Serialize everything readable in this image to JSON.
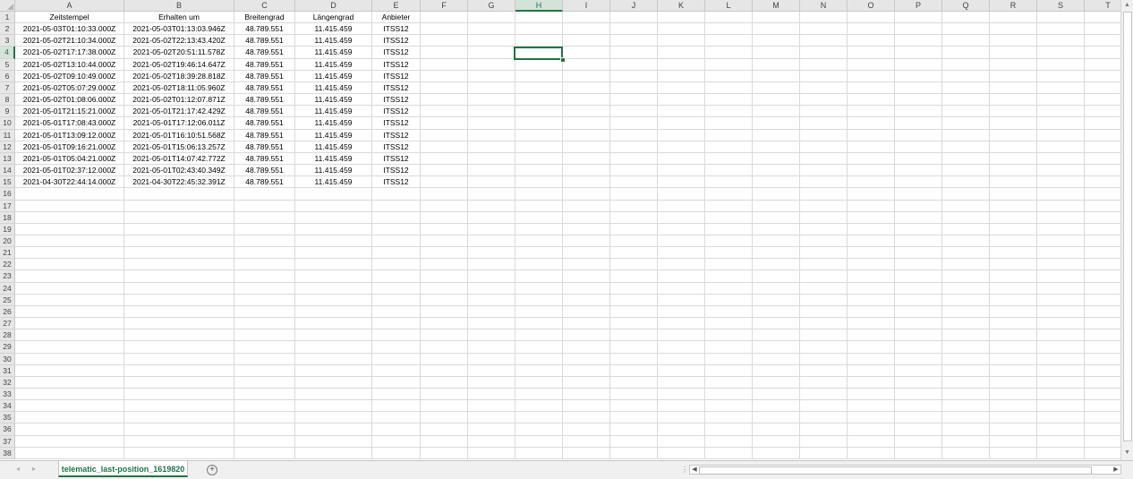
{
  "app": {
    "accent_color": "#217346"
  },
  "columns": [
    "A",
    "B",
    "C",
    "D",
    "E",
    "F",
    "G",
    "H",
    "I",
    "J",
    "K",
    "L",
    "M",
    "N",
    "O",
    "P",
    "Q",
    "R",
    "S",
    "T"
  ],
  "selected_column": "H",
  "selected_row": 4,
  "row_count": 38,
  "rows": [
    [
      "Zeitstempel",
      "Erhalten um",
      "Breitengrad",
      "Längengrad",
      "Anbieter"
    ],
    [
      "2021-05-03T01:10:33.000Z",
      "2021-05-03T01:13:03.946Z",
      "48.789.551",
      "11.415.459",
      "ITSS12"
    ],
    [
      "2021-05-02T21:10:34.000Z",
      "2021-05-02T22:13:43.420Z",
      "48.789.551",
      "11.415.459",
      "ITSS12"
    ],
    [
      "2021-05-02T17:17:38.000Z",
      "2021-05-02T20:51:11.578Z",
      "48.789.551",
      "11.415.459",
      "ITSS12"
    ],
    [
      "2021-05-02T13:10:44.000Z",
      "2021-05-02T19:46:14.647Z",
      "48.789.551",
      "11.415.459",
      "ITSS12"
    ],
    [
      "2021-05-02T09:10:49.000Z",
      "2021-05-02T18:39:28.818Z",
      "48.789.551",
      "11.415.459",
      "ITSS12"
    ],
    [
      "2021-05-02T05:07:29.000Z",
      "2021-05-02T18:11:05.960Z",
      "48.789.551",
      "11.415.459",
      "ITSS12"
    ],
    [
      "2021-05-02T01:08:06.000Z",
      "2021-05-02T01:12:07.871Z",
      "48.789.551",
      "11.415.459",
      "ITSS12"
    ],
    [
      "2021-05-01T21:15:21.000Z",
      "2021-05-01T21:17:42.429Z",
      "48.789.551",
      "11.415.459",
      "ITSS12"
    ],
    [
      "2021-05-01T17:08:43.000Z",
      "2021-05-01T17:12:06.011Z",
      "48.789.551",
      "11.415.459",
      "ITSS12"
    ],
    [
      "2021-05-01T13:09:12.000Z",
      "2021-05-01T16:10:51.568Z",
      "48.789.551",
      "11.415.459",
      "ITSS12"
    ],
    [
      "2021-05-01T09:16:21.000Z",
      "2021-05-01T15:06:13.257Z",
      "48.789.551",
      "11.415.459",
      "ITSS12"
    ],
    [
      "2021-05-01T05:04:21.000Z",
      "2021-05-01T14:07:42.772Z",
      "48.789.551",
      "11.415.459",
      "ITSS12"
    ],
    [
      "2021-05-01T02:37:12.000Z",
      "2021-05-01T02:43:40.349Z",
      "48.789.551",
      "11.415.459",
      "ITSS12"
    ],
    [
      "2021-04-30T22:44:14.000Z",
      "2021-04-30T22:45:32.391Z",
      "48.789.551",
      "11.415.459",
      "ITSS12"
    ]
  ],
  "sheet_tabs": [
    "telematic_last-position_1619820"
  ],
  "active_sheet": "telematic_last-position_1619820",
  "icons": {
    "add_sheet": "plus-circle-icon",
    "scroll_up": "triangle-up-icon",
    "scroll_down": "triangle-down-icon",
    "scroll_left": "triangle-left-icon",
    "scroll_right": "triangle-right-icon",
    "nav_prev": "chevron-left-icon",
    "nav_next": "chevron-right-icon"
  }
}
